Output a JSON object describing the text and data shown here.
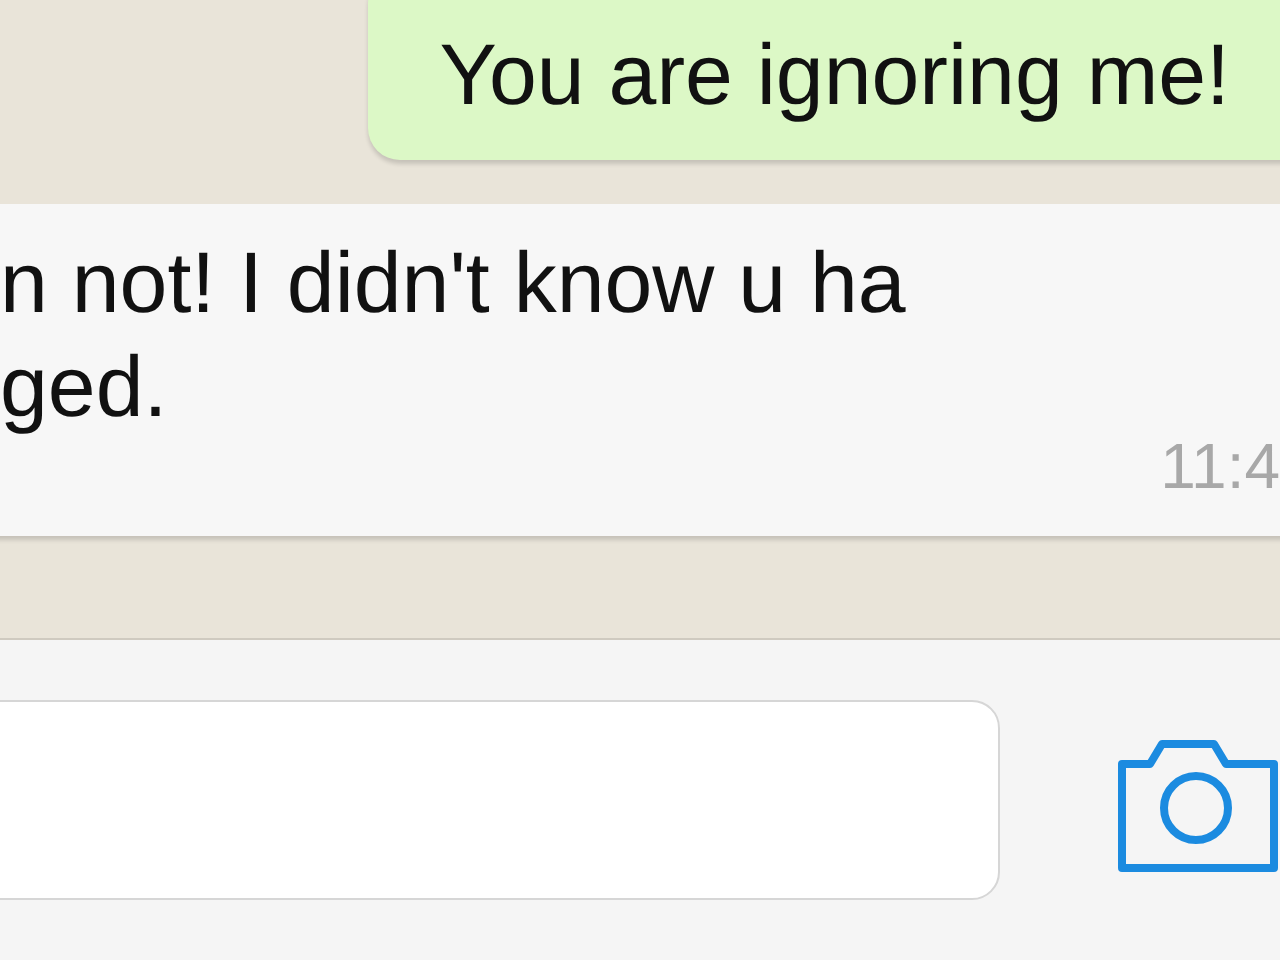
{
  "messages": [
    {
      "kind": "outgoing",
      "lines": [
        "You are ignoring me!"
      ]
    },
    {
      "kind": "incoming",
      "lines": [
        "n not! I didn't know u ha",
        "ged."
      ],
      "time": "11:4"
    }
  ]
}
